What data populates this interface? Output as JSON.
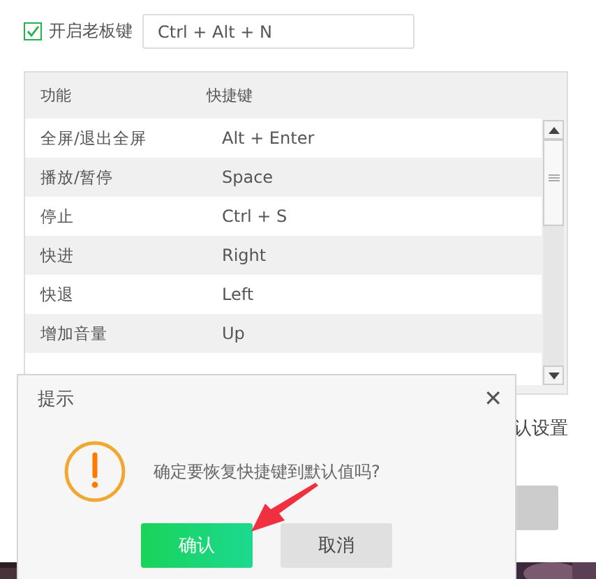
{
  "boss_key": {
    "label": "开启老板键",
    "checked": true,
    "value": "Ctrl + Alt + N"
  },
  "table": {
    "columns": [
      "功能",
      "快捷键"
    ],
    "rows": [
      {
        "function": "全屏/退出全屏",
        "shortcut": "Alt + Enter"
      },
      {
        "function": "播放/暂停",
        "shortcut": "Space"
      },
      {
        "function": "停止",
        "shortcut": "Ctrl + S"
      },
      {
        "function": "快进",
        "shortcut": "Right"
      },
      {
        "function": "快退",
        "shortcut": "Left"
      },
      {
        "function": "增加音量",
        "shortcut": "Up"
      }
    ]
  },
  "behind_text": "认设置",
  "dialog": {
    "title": "提示",
    "close": "✕",
    "message": "确定要恢复快捷键到默认值吗?",
    "buttons": [
      {
        "label": "确认",
        "kind": "primary"
      },
      {
        "label": "取消",
        "kind": "secondary"
      }
    ]
  }
}
